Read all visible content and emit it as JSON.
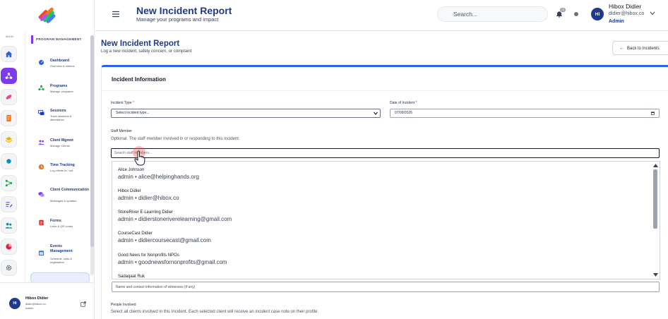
{
  "sidebar": {
    "rail_label": "MAIN",
    "section_label": "PROGRAM MANAGEMENT",
    "items": [
      {
        "title": "Dashboard",
        "sub": "Overview & metrics",
        "icon": "dashboard-icon",
        "color": "#2563eb"
      },
      {
        "title": "Programs",
        "sub": "Manage programs",
        "icon": "programs-icon",
        "color": "#16a34a"
      },
      {
        "title": "Sessions",
        "sub": "Track sessions & attendance",
        "icon": "sessions-icon",
        "color": "#1e40af"
      },
      {
        "title": "Client Mgmnt",
        "sub": "Manage Clients",
        "icon": "clients-icon",
        "color": "#7c3aed"
      },
      {
        "title": "Time Tracking",
        "sub": "Log clients in / out",
        "icon": "clock-icon",
        "color": "#f97316"
      },
      {
        "title": "Client Communication",
        "sub": "Messages & updates",
        "icon": "chat-icon",
        "color": "#7c3aed"
      },
      {
        "title": "Forms",
        "sub": "Links & QR codes",
        "icon": "forms-icon",
        "color": "#dc2626"
      },
      {
        "title": "Events Management",
        "sub": "Schedule, slots & registration",
        "icon": "events-icon",
        "color": "#2563eb"
      }
    ],
    "user": {
      "initials": "HI",
      "name": "Hibox Didier",
      "email": "didier@hibox.co",
      "role": "Admin"
    }
  },
  "header": {
    "title": "New Incident Report",
    "subtitle": "Manage your programs and impact",
    "search_placeholder": "Search...",
    "notif_count": "10",
    "user": {
      "initials": "HI",
      "name": "Hibox Didier",
      "email": "didier@hibox.co",
      "role": "Admin"
    }
  },
  "page": {
    "title": "New Incident Report",
    "subtitle": "Log a new incident, safety concern, or complaint",
    "back_label": "Back to Incidents"
  },
  "form": {
    "card_title": "Incident Information",
    "incident_type_label": "Incident Type",
    "incident_type_value": "Select incident type...",
    "date_label": "Date of Incident",
    "date_value": "07/09/2026",
    "staff_label": "Staff Member",
    "staff_help": "Optional. The staff member involved in or responding to this incident.",
    "staff_placeholder": "Search staff members...",
    "staff_options": [
      {
        "name": "Alice Johnson",
        "detail": "admin • alice@helpinghands.org"
      },
      {
        "name": "Hibox Didier",
        "detail": "admin • didier@hibox.co"
      },
      {
        "name": "StoneRiver E-Learning Didier",
        "detail": "admin • didierstoneriverelearning@gmail.com"
      },
      {
        "name": "CourseCast Didier",
        "detail": "admin • didiercoursecast@gmail.com"
      },
      {
        "name": "Good News for Nonprofits NPOs",
        "detail": "admin • goodnewsfornonprofits@gmail.com"
      },
      {
        "name": "Sadaqaat Ruk",
        "detail": ""
      }
    ],
    "witness_placeholder": "Name and contact information of witnesses (if any)",
    "people_label": "People Involved",
    "people_help": "Select all clients involved in this Incident. Each selected client will receive an incident case note on their profile."
  },
  "colors": {
    "accent": "#1e3a8a",
    "primary": "#2563eb",
    "active_rail": "#7c3aed"
  }
}
